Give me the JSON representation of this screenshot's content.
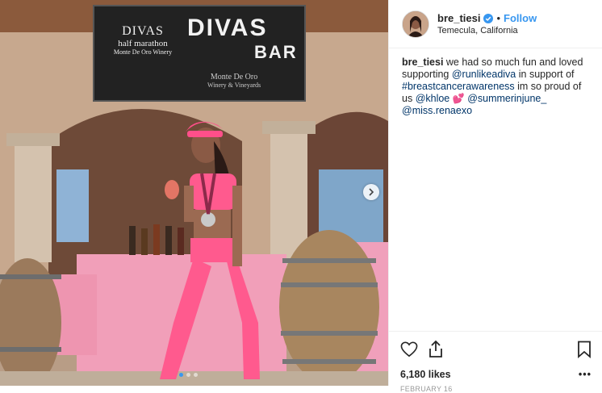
{
  "banner": {
    "logo_line1": "DIVAS",
    "logo_line2": "half marathon",
    "logo_line3": "Monte De Oro Winery",
    "big_title": "DIVAS",
    "big_sub": "BAR",
    "winery_line1": "Monte De Oro",
    "winery_line2": "Winery & Vineyards"
  },
  "carousel": {
    "dot_count": 3,
    "active_index": 0
  },
  "post": {
    "username": "bre_tiesi",
    "follow_label": "Follow",
    "separator": "•",
    "location": "Temecula, California",
    "caption_username": "bre_tiesi",
    "caption_part1": " we had so much fun and loved supporting ",
    "mention_1": "@runlikeadiva",
    "caption_part2": " in support of ",
    "hashtag_1": "#breastcancerawareness",
    "caption_part3": " im so proud of us ",
    "mention_2": "@khloe",
    "emoji": "💕",
    "mention_3": "@summerinjune_",
    "mention_4": "@miss.renaexo",
    "likes": "6,180 likes",
    "date": "FEBRUARY 16",
    "more": "•••"
  },
  "icons": [
    "heart-icon",
    "share-icon",
    "bookmark-icon",
    "verified-icon",
    "chevron-right-icon"
  ],
  "colors": {
    "accent": "#3897f0",
    "link": "#003569",
    "pink": "#ff4fa3"
  }
}
